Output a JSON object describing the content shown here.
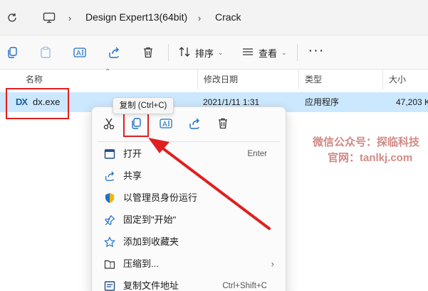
{
  "address": {
    "breadcrumbs": [
      "Design Expert13(64bit)",
      "Crack"
    ],
    "icons": [
      "refresh-icon",
      "this-pc-icon",
      "chevron-right-icon"
    ]
  },
  "toolbar": {
    "sort_label": "排序",
    "view_label": "查看",
    "more_label": "···",
    "icons": [
      "copy-icon",
      "paste-icon",
      "rename-icon",
      "share-icon",
      "delete-icon",
      "sort-icon",
      "view-icon"
    ]
  },
  "columns": [
    "名称",
    "修改日期",
    "类型",
    "大小"
  ],
  "file": {
    "icon_text": "DX",
    "name": "dx.exe",
    "modified": "2021/1/11 1:31",
    "type": "应用程序",
    "size": "47,203 K"
  },
  "tooltip": "复制 (Ctrl+C)",
  "context_menu": {
    "quick_actions": [
      "cut-icon",
      "copy-icon",
      "rename-icon",
      "share-icon",
      "delete-icon"
    ],
    "items": [
      {
        "label": "打开",
        "shortcut": "Enter",
        "icon": "open-icon"
      },
      {
        "label": "共享",
        "shortcut": "",
        "icon": "share-icon"
      },
      {
        "label": "以管理员身份运行",
        "shortcut": "",
        "icon": "admin-shield-icon"
      },
      {
        "label": "固定到\"开始\"",
        "shortcut": "",
        "icon": "pin-icon"
      },
      {
        "label": "添加到收藏夹",
        "shortcut": "",
        "icon": "star-icon"
      },
      {
        "label": "压缩到...",
        "shortcut": "",
        "icon": "zip-folder-icon",
        "submenu": "›"
      },
      {
        "label": "复制文件地址",
        "shortcut": "Ctrl+Shift+C",
        "icon": "copy-path-icon"
      }
    ]
  },
  "watermark": {
    "line1": "微信公众号：探临科技",
    "line2": "官网：tanlkj.com"
  },
  "colors": {
    "selection": "#cce8ff",
    "annotation_red": "#e02020",
    "watermark": "#d08a86"
  }
}
